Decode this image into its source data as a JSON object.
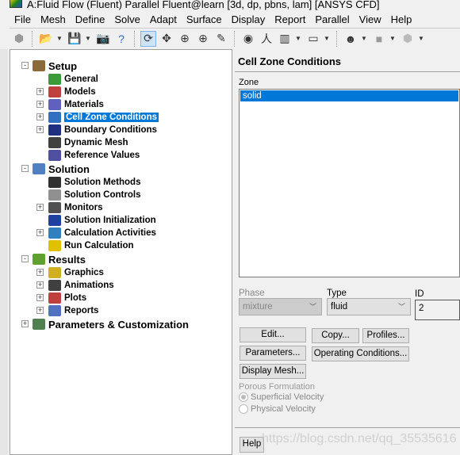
{
  "window": {
    "title": "A:Fluid Flow (Fluent) Parallel Fluent@learn  [3d, dp, pbns, lam] [ANSYS CFD]"
  },
  "menu": [
    "File",
    "Mesh",
    "Define",
    "Solve",
    "Adapt",
    "Surface",
    "Display",
    "Report",
    "Parallel",
    "View",
    "Help"
  ],
  "tree": [
    {
      "label": "Setup",
      "level": 0,
      "expander": "-",
      "color": "#8a6a3a"
    },
    {
      "label": "General",
      "level": 1,
      "expander": "",
      "color": "#3a9a3a"
    },
    {
      "label": "Models",
      "level": 1,
      "expander": "+",
      "color": "#c04040"
    },
    {
      "label": "Materials",
      "level": 1,
      "expander": "+",
      "color": "#6060c0"
    },
    {
      "label": "Cell Zone Conditions",
      "level": 1,
      "expander": "+",
      "color": "#3070c0",
      "selected": true
    },
    {
      "label": "Boundary Conditions",
      "level": 1,
      "expander": "+",
      "color": "#203080"
    },
    {
      "label": "Dynamic Mesh",
      "level": 1,
      "expander": "",
      "color": "#404040"
    },
    {
      "label": "Reference Values",
      "level": 1,
      "expander": "",
      "color": "#5050a0"
    },
    {
      "label": "Solution",
      "level": 0,
      "expander": "-",
      "color": "#5080c0"
    },
    {
      "label": "Solution Methods",
      "level": 1,
      "expander": "",
      "color": "#303030"
    },
    {
      "label": "Solution Controls",
      "level": 1,
      "expander": "",
      "color": "#909090"
    },
    {
      "label": "Monitors",
      "level": 1,
      "expander": "+",
      "color": "#505050"
    },
    {
      "label": "Solution Initialization",
      "level": 1,
      "expander": "",
      "color": "#2040a0"
    },
    {
      "label": "Calculation Activities",
      "level": 1,
      "expander": "+",
      "color": "#3080c0"
    },
    {
      "label": "Run Calculation",
      "level": 1,
      "expander": "",
      "color": "#e0c000"
    },
    {
      "label": "Results",
      "level": 0,
      "expander": "-",
      "color": "#60a030"
    },
    {
      "label": "Graphics",
      "level": 1,
      "expander": "+",
      "color": "#d0b020"
    },
    {
      "label": "Animations",
      "level": 1,
      "expander": "+",
      "color": "#404040"
    },
    {
      "label": "Plots",
      "level": 1,
      "expander": "+",
      "color": "#c04040"
    },
    {
      "label": "Reports",
      "level": 1,
      "expander": "+",
      "color": "#5070c0"
    },
    {
      "label": "Parameters & Customization",
      "level": 0,
      "expander": "+",
      "color": "#508050"
    }
  ],
  "panel": {
    "title": "Cell Zone Conditions",
    "zone_label": "Zone",
    "zones": [
      "solid"
    ],
    "phase_label": "Phase",
    "phase_value": "mixture",
    "type_label": "Type",
    "type_value": "fluid",
    "id_label": "ID",
    "id_value": "2",
    "buttons": {
      "edit": "Edit...",
      "copy": "Copy...",
      "profiles": "Profiles...",
      "parameters": "Parameters...",
      "operating": "Operating Conditions...",
      "display_mesh": "Display Mesh..."
    },
    "porous_label": "Porous Formulation",
    "porous_options": [
      {
        "label": "Superficial Velocity",
        "selected": true
      },
      {
        "label": "Physical Velocity",
        "selected": false
      }
    ],
    "help": "Help"
  },
  "watermark": "https://blog.csdn.net/qq_35535616"
}
